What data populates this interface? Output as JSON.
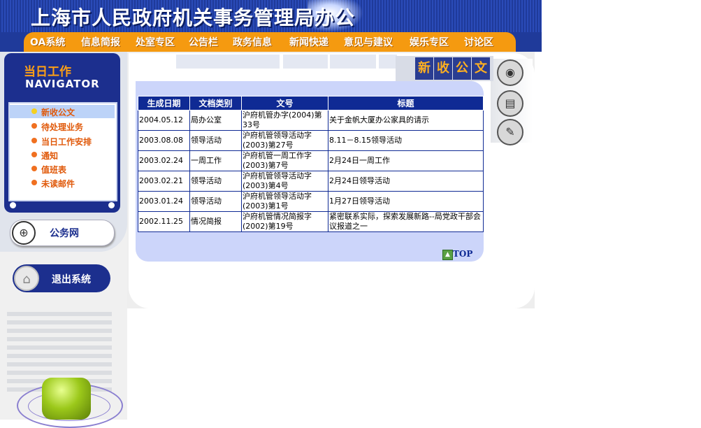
{
  "header": {
    "title": "上海市人民政府机关事务管理局办公",
    "nav": [
      "OA系统",
      "信息简报",
      "处室专区",
      "公告栏",
      "政务信息",
      "新闻快递",
      "意见与建议",
      "娱乐专区",
      "讨论区"
    ]
  },
  "sidebar": {
    "heading_cn": "当日工作",
    "heading_en": "NAVIGATOR",
    "items": [
      {
        "label": "新收公文",
        "active": true
      },
      {
        "label": "待处理业务",
        "active": false
      },
      {
        "label": "当日工作安排",
        "active": false
      },
      {
        "label": "通知",
        "active": false
      },
      {
        "label": "值班表",
        "active": false
      },
      {
        "label": "未读邮件",
        "active": false
      }
    ],
    "gwy_label": "公务网",
    "exit_label": "退出系统"
  },
  "main": {
    "title_chars": [
      "新",
      "收",
      "公",
      "文"
    ],
    "table": {
      "headers": [
        "生成日期",
        "文档类别",
        "文号",
        "标题"
      ],
      "rows": [
        [
          "2004.05.12",
          "局办公室",
          "沪府机管办字(2004)第33号",
          "关于金帆大厦办公家具的请示"
        ],
        [
          "2003.08.08",
          "领导活动",
          "沪府机管领导活动字(2003)第27号",
          "8.11－8.15领导活动"
        ],
        [
          "2003.02.24",
          "一周工作",
          "沪府机管一周工作字(2003)第7号",
          "2月24日一周工作"
        ],
        [
          "2003.02.21",
          "领导活动",
          "沪府机管领导活动字(2003)第4号",
          "2月24日领导活动"
        ],
        [
          "2003.01.24",
          "领导活动",
          "沪府机管领导活动字(2003)第1号",
          "1月27日领导活动"
        ],
        [
          "2002.11.25",
          "情况简报",
          "沪府机管情况简报字(2002)第19号",
          "紧密联系实际，探索发展新路--局党政干部会议报道之一"
        ]
      ]
    },
    "top_label": "TOP"
  },
  "icons": [
    "disk-icon",
    "notebook-icon",
    "pens-icon",
    "home-icon",
    "network-icon",
    "up-arrow-icon"
  ],
  "colors": {
    "navy": "#1c2f8e",
    "orange": "#f59a10",
    "table_header": "#0f2a94",
    "panel": "#ccd5fa"
  }
}
